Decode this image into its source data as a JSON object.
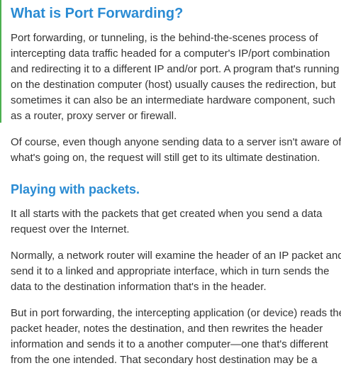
{
  "article": {
    "heading_main": "What is Port Forwarding?",
    "heading_sub": "Playing with packets.",
    "paragraphs": [
      {
        "lines": [
          "Port forwarding, or tunneling, is the behind-the-scenes process of",
          "intercepting data traffic headed for a computer's IP/port combination",
          "and redirecting it to a different IP and/or port. A program that's running",
          "on the destination computer (host) usually causes the redirection, but",
          "sometimes it can also be an intermediate hardware component, such",
          "as a router, proxy server or firewall."
        ]
      },
      {
        "lines": [
          "Of course, even though anyone sending data to a server isn't aware of",
          "what's going on, the request will still get to its ultimate destination."
        ]
      },
      {
        "lines": [
          "It all starts with the packets that get created when you send a data",
          "request over the Internet."
        ]
      },
      {
        "lines": [
          "Normally, a network router will examine the header of an IP packet and",
          "send it to a linked and appropriate interface, which in turn sends the",
          "data to the destination information that's in the header."
        ]
      },
      {
        "lines": [
          "But in port forwarding, the intercepting application (or device) reads the",
          "packet header, notes the destination, and then rewrites the header",
          "information and sends it to a another computer—one that's different",
          "from the one intended. That secondary host destination may be a"
        ]
      }
    ]
  },
  "colors": {
    "heading": "#2a8bd3",
    "body_text": "#333333",
    "accent_bar": "#4caf50"
  }
}
